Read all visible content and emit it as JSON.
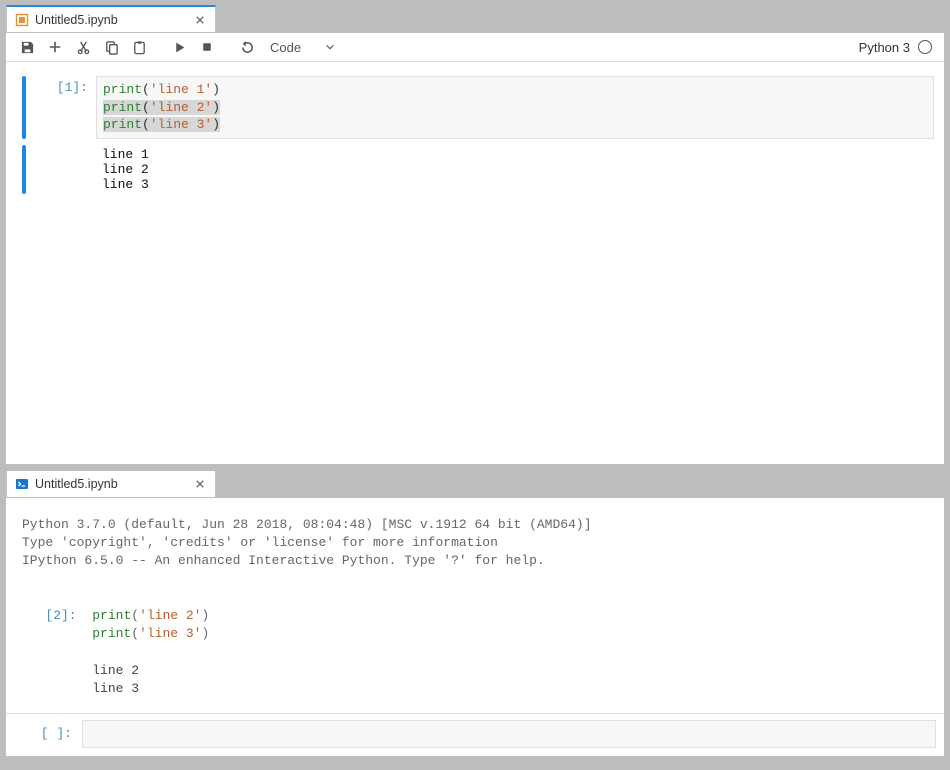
{
  "notebook": {
    "tab_title": "Untitled5.ipynb",
    "toolbar": {
      "cell_type": "Code",
      "kernel_name": "Python 3"
    },
    "cell": {
      "prompt": "[1]:",
      "code": {
        "l1_fn": "print",
        "l1_str": "'line 1'",
        "l2_fn": "print",
        "l2_str": "'line 2'",
        "l3_fn": "print",
        "l3_str": "'line 3'"
      }
    },
    "output": "line 1\nline 2\nline 3"
  },
  "console": {
    "tab_title": "Untitled5.ipynb",
    "banner": "Python 3.7.0 (default, Jun 28 2018, 08:04:48) [MSC v.1912 64 bit (AMD64)]\nType 'copyright', 'credits' or 'license' for more information\nIPython 6.5.0 -- An enhanced Interactive Python. Type '?' for help.",
    "in_prompt": "[2]:",
    "code": {
      "l1_fn": "print",
      "l1_str": "'line 2'",
      "l2_fn": "print",
      "l2_str": "'line 3'"
    },
    "output": "line 2\nline 3",
    "input_prompt": "[ ]:"
  }
}
